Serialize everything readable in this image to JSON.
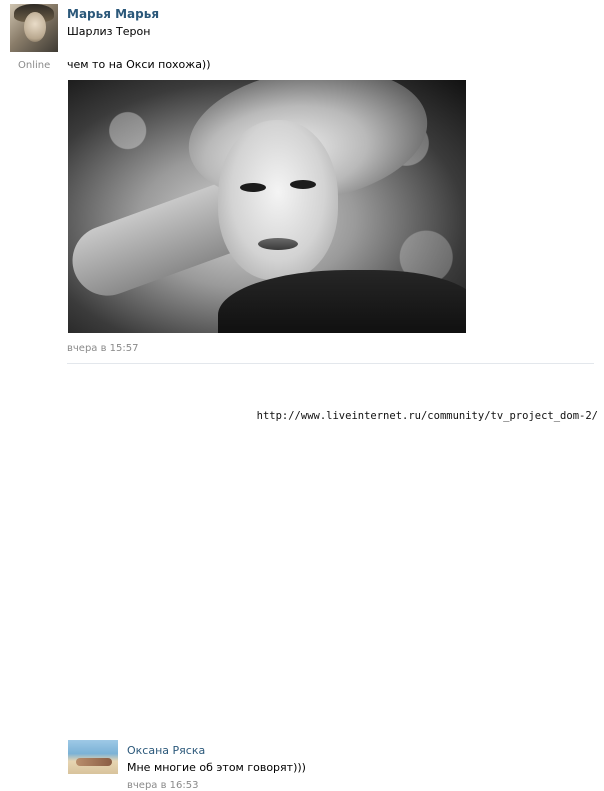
{
  "post": {
    "author_name": "Марья Марья",
    "author_status": "Online",
    "text_line1": "Шарлиз Терон",
    "text_line2": "чем то на Окси похожа))",
    "photo_icon": "portrait-photo",
    "timestamp": "вчера в 15:57"
  },
  "comment": {
    "author_name": "Оксана Ряска",
    "text": "Мне многие об этом говорят)))",
    "timestamp": "вчера в 16:53",
    "avatar_icon": "beach-avatar"
  },
  "watermark": {
    "text": "http://www.liveinternet.ru/community/tv_project_dom-2/"
  },
  "colors": {
    "link": "#2b587a",
    "meta": "#8a8a8a",
    "divider": "#e3e7ec"
  }
}
